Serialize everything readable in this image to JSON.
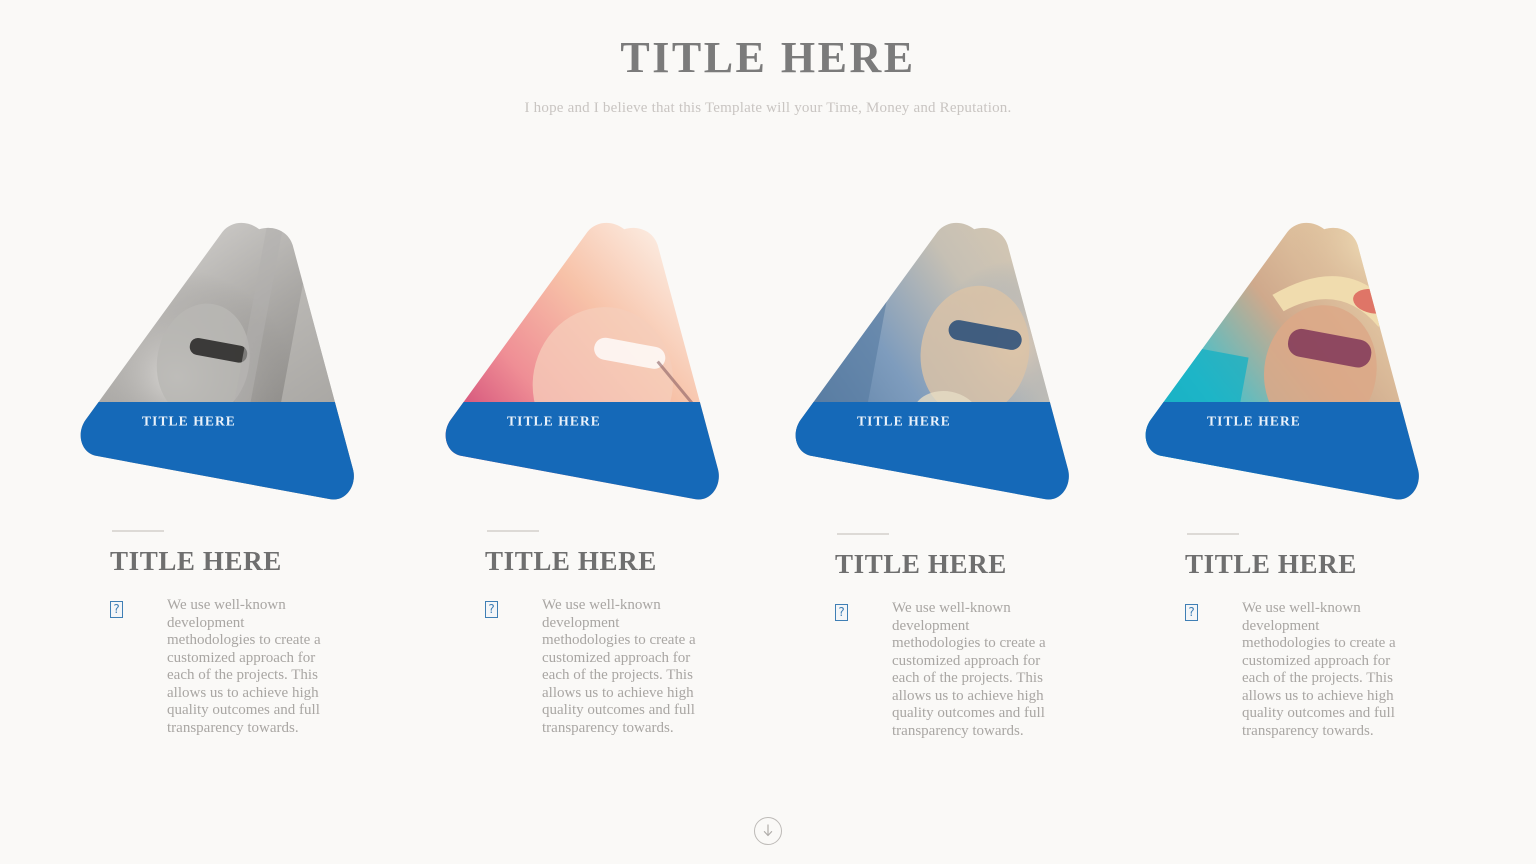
{
  "header": {
    "title": "TITLE HERE",
    "subtitle": "I hope and I believe that this Template will your Time, Money and Reputation."
  },
  "theme": {
    "background": "#faf9f7",
    "accent_blue": "#1569b8",
    "title_gray": "#7b7b7b",
    "body_gray": "#a9a6a3",
    "rule_gray": "#dddad6"
  },
  "cards": [
    {
      "label": "TITLE HERE",
      "image_alt": "woman in sunglasses black and white street",
      "photo_colors": [
        "#cfcdca",
        "#8d8b88",
        "#b6b4b1",
        "#6e6c6a"
      ]
    },
    {
      "label": "TITLE HERE",
      "image_alt": "woman in aviator sunglasses pink sunset light",
      "photo_colors": [
        "#f6e9e2",
        "#f2a0ab",
        "#e0597f",
        "#f7c9ad"
      ]
    },
    {
      "label": "TITLE HERE",
      "image_alt": "woman in sunglasses with braids blue tones",
      "photo_colors": [
        "#6f93bd",
        "#3f6f9f",
        "#cbb69c",
        "#9fb8d2"
      ]
    },
    {
      "label": "TITLE HERE",
      "image_alt": "woman in sun hat by a swimming pool",
      "photo_colors": [
        "#19b7c9",
        "#e8d6a9",
        "#d79a7c",
        "#14a0b5"
      ]
    }
  ],
  "columns": [
    {
      "title": "TITLE HERE",
      "bullet_icon": "missing-glyph-box",
      "bullet_glyph": "?",
      "text": "We use well-known development methodologies to create a customized approach for each of the projects. This allows us to achieve high quality outcomes and full transparency towards."
    },
    {
      "title": "TITLE HERE",
      "bullet_icon": "missing-glyph-box",
      "bullet_glyph": "?",
      "text": "We use well-known development methodologies to create a customized approach for each of the projects. This allows us to achieve high quality outcomes and full transparency towards."
    },
    {
      "title": "TITLE HERE",
      "bullet_icon": "missing-glyph-box",
      "bullet_glyph": "?",
      "text": "We use well-known development methodologies to create a customized approach for each of the projects. This allows us to achieve high quality outcomes and full transparency towards."
    },
    {
      "title": "TITLE HERE",
      "bullet_icon": "missing-glyph-box",
      "bullet_glyph": "?",
      "text": "We use well-known development methodologies to create a customized approach for each of the projects. This allows us to achieve high quality outcomes and full transparency towards."
    }
  ],
  "footer": {
    "scroll_icon": "arrow-down-circle-icon"
  }
}
